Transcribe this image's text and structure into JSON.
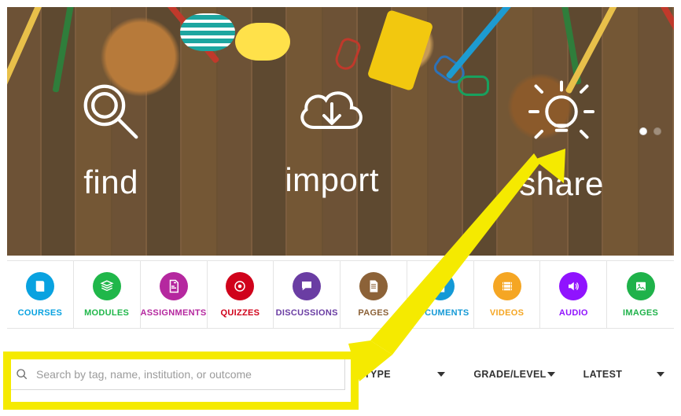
{
  "hero": {
    "items": [
      {
        "label": "find",
        "icon": "magnify-icon"
      },
      {
        "label": "import",
        "icon": "cloud-download-icon"
      },
      {
        "label": "share",
        "icon": "lightbulb-icon"
      }
    ]
  },
  "categories": [
    {
      "label": "COURSES",
      "icon": "book-icon",
      "color": "#09a2e0",
      "labelColor": "#09a2e0"
    },
    {
      "label": "MODULES",
      "icon": "stack-icon",
      "color": "#20b74a",
      "labelColor": "#20b74a"
    },
    {
      "label": "ASSIGNMENTS",
      "icon": "assignment-icon",
      "color": "#b5289f",
      "labelColor": "#b5289f"
    },
    {
      "label": "QUIZZES",
      "icon": "target-icon",
      "color": "#d0021b",
      "labelColor": "#d0021b"
    },
    {
      "label": "DISCUSSIONS",
      "icon": "chat-icon",
      "color": "#6a3da3",
      "labelColor": "#6a3da3"
    },
    {
      "label": "PAGES",
      "icon": "file-lines-icon",
      "color": "#8c6238",
      "labelColor": "#8c6238"
    },
    {
      "label": "DOCUMENTS",
      "icon": "file-lines-icon",
      "color": "#1499d6",
      "labelColor": "#1499d6"
    },
    {
      "label": "VIDEOS",
      "icon": "film-icon",
      "color": "#f5a623",
      "labelColor": "#f5a623"
    },
    {
      "label": "AUDIO",
      "icon": "speaker-icon",
      "color": "#9013fe",
      "labelColor": "#9013fe"
    },
    {
      "label": "IMAGES",
      "icon": "picture-icon",
      "color": "#1fb24a",
      "labelColor": "#1fb24a"
    }
  ],
  "search": {
    "placeholder": "Search by tag, name, institution, or outcome",
    "value": ""
  },
  "dropdowns": [
    {
      "label": "TYPE"
    },
    {
      "label": "GRADE/LEVEL"
    },
    {
      "label": "LATEST"
    }
  ],
  "annotation": {
    "color": "#f5ea00"
  }
}
